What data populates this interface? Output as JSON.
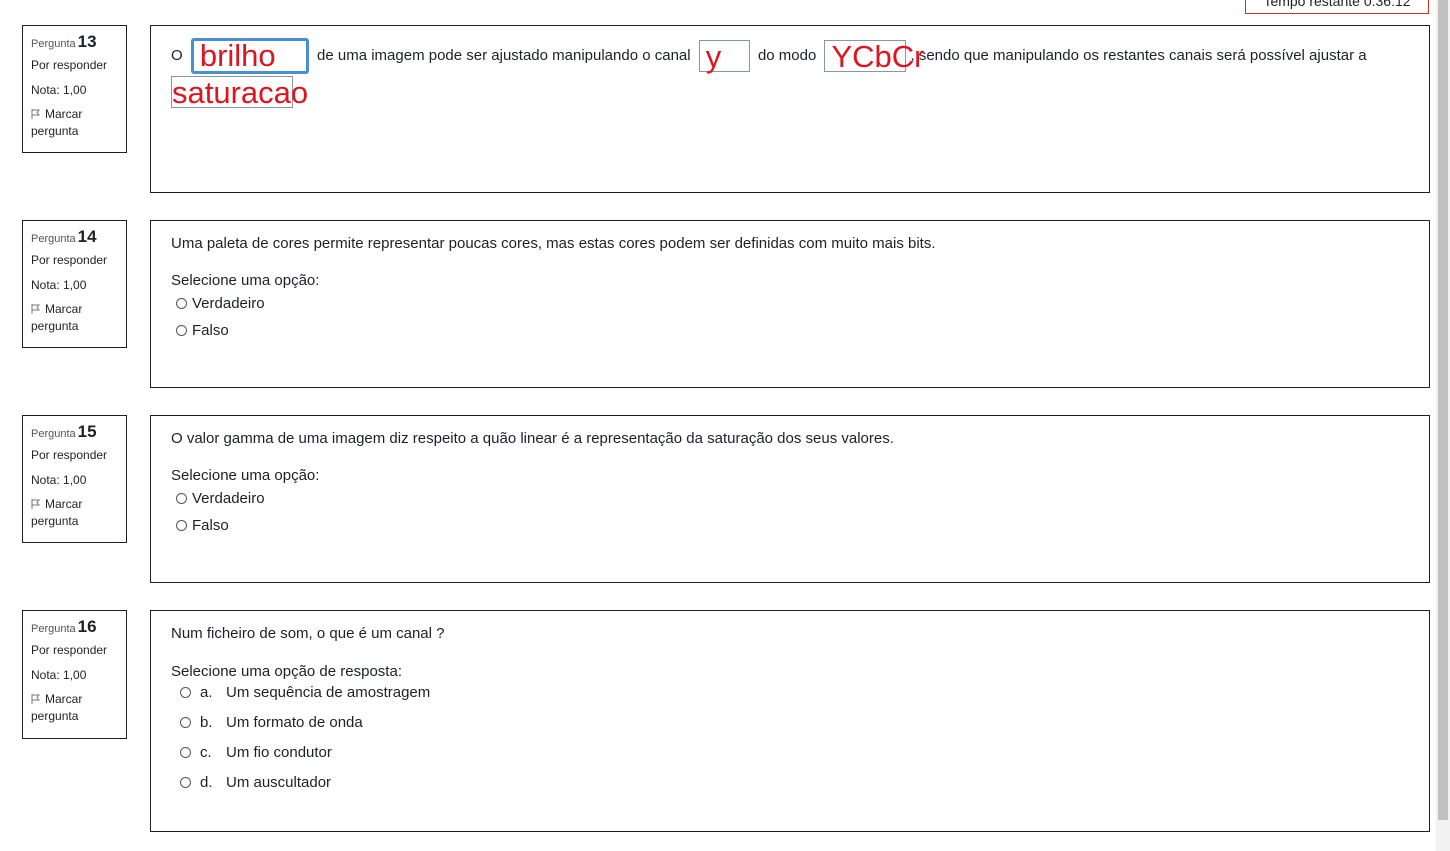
{
  "timer": "Tempo restante 0:36:12",
  "questions": [
    {
      "label": "Pergunta",
      "number": "13",
      "state": "Por responder",
      "grade": "Nota: 1,00",
      "flag": "Marcar pergunta",
      "text_parts": [
        "O",
        "de uma imagem pode ser ajustado manipulando o canal",
        "do modo",
        ", sendo que manipulando os restantes canais será possível ajustar a"
      ],
      "blanks": [
        "brilho",
        "y",
        "YCbCr",
        "saturacao"
      ]
    },
    {
      "label": "Pergunta",
      "number": "14",
      "state": "Por responder",
      "grade": "Nota: 1,00",
      "flag": "Marcar pergunta",
      "text": "Uma paleta de cores permite representar poucas cores, mas estas cores podem ser definidas com muito mais bits.",
      "prompt": "Selecione uma opção:",
      "options": [
        "Verdadeiro",
        "Falso"
      ]
    },
    {
      "label": "Pergunta",
      "number": "15",
      "state": "Por responder",
      "grade": "Nota: 1,00",
      "flag": "Marcar pergunta",
      "text": "O valor gamma de uma imagem diz respeito a quão linear é a representação da saturação dos seus valores.",
      "prompt": "Selecione uma opção:",
      "options": [
        "Verdadeiro",
        "Falso"
      ]
    },
    {
      "label": "Pergunta",
      "number": "16",
      "state": "Por responder",
      "grade": "Nota: 1,00",
      "flag": "Marcar pergunta",
      "text": "Num ficheiro de som, o que é um canal ?",
      "prompt": "Selecione uma opção de resposta:",
      "options": [
        {
          "letter": "a.",
          "label": "Um sequência de amostragem"
        },
        {
          "letter": "b.",
          "label": "Um formato de onda"
        },
        {
          "letter": "c.",
          "label": "Um fio condutor"
        },
        {
          "letter": "d.",
          "label": "Um auscultador"
        }
      ]
    }
  ],
  "colors": {
    "answer_text": "#e0141e",
    "focus_border": "#4a8fd0",
    "timer_border": "#ca3120"
  }
}
